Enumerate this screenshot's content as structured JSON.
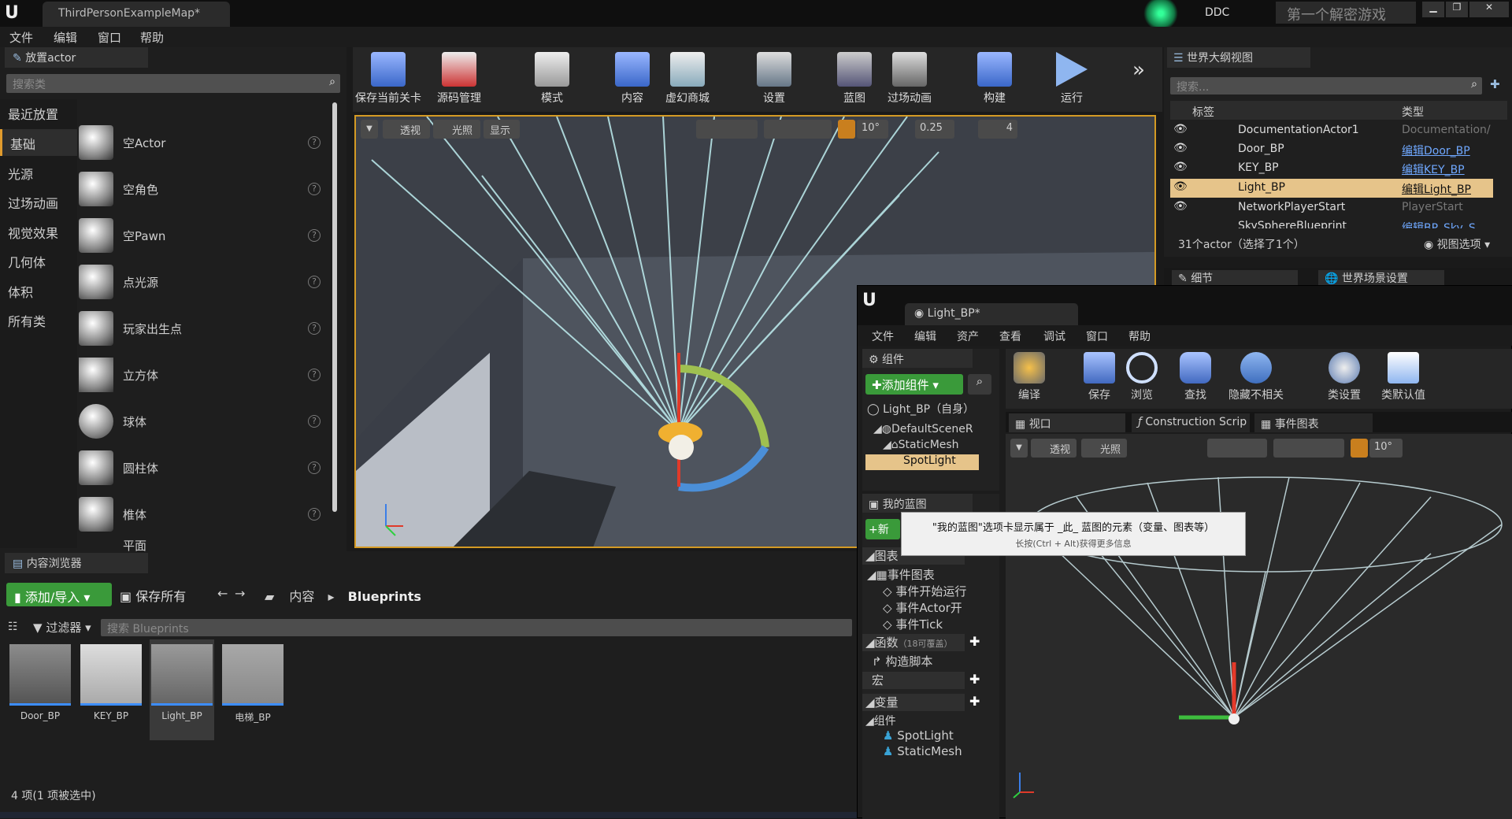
{
  "title_bar": {
    "tab": "ThirdPersonExampleMap*",
    "ddc": "DDC",
    "project": "第一个解密游戏"
  },
  "menu": [
    "文件",
    "编辑",
    "窗口",
    "帮助"
  ],
  "place_actor": {
    "title": "放置actor",
    "search_placeholder": "搜索类",
    "categories": [
      "最近放置",
      "基础",
      "光源",
      "过场动画",
      "视觉效果",
      "几何体",
      "体积",
      "所有类"
    ],
    "items": [
      "空Actor",
      "空角色",
      "空Pawn",
      "点光源",
      "玩家出生点",
      "立方体",
      "球体",
      "圆柱体",
      "椎体",
      "平面"
    ]
  },
  "toolbar": [
    "保存当前关卡",
    "源码管理",
    "模式",
    "内容",
    "虚幻商城",
    "设置",
    "蓝图",
    "过场动画",
    "构建",
    "运行"
  ],
  "viewport": {
    "perspective": "透视",
    "lit": "光照",
    "show": "显示",
    "snap_angle": "10°",
    "scale": "0.25",
    "camera_speed": "4"
  },
  "outliner": {
    "title": "世界大纲视图",
    "search_placeholder": "搜索...",
    "col_label": "标签",
    "col_type": "类型",
    "rows": [
      {
        "name": "DocumentationActor1",
        "type": "Documentation/",
        "link": false
      },
      {
        "name": "Door_BP",
        "type": "编辑Door_BP",
        "link": true
      },
      {
        "name": "KEY_BP",
        "type": "编辑KEY_BP",
        "link": true
      },
      {
        "name": "Light_BP",
        "type": "编辑Light_BP",
        "link": true
      },
      {
        "name": "NetworkPlayerStart",
        "type": "PlayerStart",
        "link": false
      },
      {
        "name": "SkySphereBlueprint",
        "type": "编辑BP_Sky_S",
        "link": true
      }
    ],
    "status": "31个actor（选择了1个）",
    "view_options": "视图选项"
  },
  "details_tabs": [
    "细节",
    "世界场景设置"
  ],
  "content_browser": {
    "title": "内容浏览器",
    "add_import": "添加/导入",
    "save_all": "保存所有",
    "path": [
      "内容",
      "Blueprints"
    ],
    "filter": "过滤器",
    "search_placeholder": "搜索 Blueprints",
    "assets": [
      "Door_BP",
      "KEY_BP",
      "Light_BP",
      "电梯_BP"
    ],
    "status": "4 项(1 项被选中)"
  },
  "bp_editor": {
    "tab": "Light_BP*",
    "menu": [
      "文件",
      "编辑",
      "资产",
      "查看",
      "调试",
      "窗口",
      "帮助"
    ],
    "components_title": "组件",
    "add_component": "添加组件",
    "self": "Light_BP（自身）",
    "tree": [
      "DefaultSceneR",
      "StaticMesh",
      "SpotLight"
    ],
    "my_blueprint": "我的蓝图",
    "new_btn": "+新增",
    "toolbar": [
      "编译",
      "保存",
      "浏览",
      "查找",
      "隐藏不相关",
      "类设置",
      "类默认值"
    ],
    "tabs": [
      "视口",
      "Construction Scrip",
      "事件图表"
    ],
    "viewport": {
      "perspective": "透视",
      "lit": "光照",
      "snap_angle": "10°"
    },
    "graphs_title": "图表",
    "event_graph": "事件图表",
    "events": [
      "事件开始运行",
      "事件Actor开",
      "事件Tick"
    ],
    "functions": "函数",
    "functions_note": "（18可覆盖）",
    "construction": "构造脚本",
    "macros": "宏",
    "variables": "变量",
    "comp_group": "组件",
    "comp_vars": [
      "SpotLight",
      "StaticMesh"
    ]
  },
  "tooltip": {
    "main": "\"我的蓝图\"选项卡显示属于 _此_ 蓝图的元素（变量、图表等）",
    "hint": "长按(Ctrl + Alt)获得更多信息"
  }
}
